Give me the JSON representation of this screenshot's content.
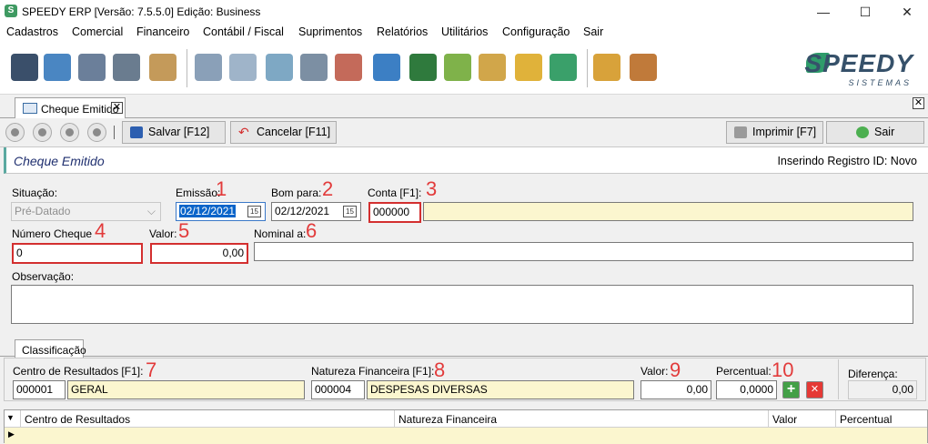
{
  "window": {
    "title": "SPEEDY ERP [Versão: 7.5.5.0] Edição: Business",
    "app_icon": "S"
  },
  "window_controls": {
    "minimize": "—",
    "maximize": "☐",
    "close": "✕"
  },
  "menu": [
    "Cadastros",
    "Comercial",
    "Financeiro",
    "Contábil / Fiscal",
    "Suprimentos",
    "Relatórios",
    "Utilitários",
    "Configuração",
    "Sair"
  ],
  "toolbar_icons": [
    {
      "name": "user-icon",
      "color": "#3a4f6a"
    },
    {
      "name": "client-icon",
      "color": "#4a86c2"
    },
    {
      "name": "group-icon",
      "color": "#6b7f9a"
    },
    {
      "name": "truck-icon",
      "color": "#6a7c8f"
    },
    {
      "name": "box-icon",
      "color": "#c49a5a"
    },
    {
      "name": "calculator-icon",
      "color": "#8aa0b8"
    },
    {
      "name": "document-icon",
      "color": "#9fb4c9"
    },
    {
      "name": "spreadsheet-icon",
      "color": "#7ea8c4"
    },
    {
      "name": "report-icon",
      "color": "#7c8fa3"
    },
    {
      "name": "code-document-icon",
      "color": "#c46a5a"
    },
    {
      "name": "web-icon",
      "color": "#3c7fc4"
    },
    {
      "name": "ledger-icon",
      "color": "#2f7a3d"
    },
    {
      "name": "money-icon",
      "color": "#7fb24a"
    },
    {
      "name": "card-icon",
      "color": "#d1a64a"
    },
    {
      "name": "folder-icon",
      "color": "#e0b23a"
    },
    {
      "name": "book-icon",
      "color": "#3aa06a"
    },
    {
      "name": "keys-user-icon",
      "color": "#d8a23a"
    },
    {
      "name": "exit-door-icon",
      "color": "#c07a3a"
    }
  ],
  "logo": {
    "text": "SPEEDY",
    "sub": "SISTEMAS"
  },
  "doc_tab": {
    "label": "Cheque Emitido",
    "close": "✕"
  },
  "panel_close": "✕",
  "actions": {
    "save": "Salvar [F12]",
    "cancel": "Cancelar [F11]",
    "print": "Imprimir [F7]",
    "exit": "Sair"
  },
  "heading": {
    "title": "Cheque Emitido",
    "status": "Inserindo Registro ID: Novo"
  },
  "form": {
    "situacao_label": "Situação:",
    "situacao_value": "Pré-Datado",
    "emissao_label": "Emissão:",
    "emissao_value": "02/12/2021",
    "bom_para_label": "Bom para:",
    "bom_para_value": "02/12/2021",
    "conta_label": "Conta [F1]:",
    "conta_code": "000000",
    "conta_desc": "",
    "numero_label": "Número Cheque",
    "numero_value": "0",
    "valor_label": "Valor:",
    "valor_value": "0,00",
    "nominal_label": "Nominal a:",
    "nominal_value": "",
    "obs_label": "Observação:",
    "obs_value": ""
  },
  "callouts": [
    "1",
    "2",
    "3",
    "4",
    "5",
    "6",
    "7",
    "8",
    "9",
    "10"
  ],
  "classificacao": {
    "tab": "Classificação",
    "centro_label": "Centro de Resultados [F1]:",
    "centro_code": "000001",
    "centro_desc": "GERAL",
    "natureza_label": "Natureza Financeira [F1]:",
    "natureza_code": "000004",
    "natureza_desc": "DESPESAS DIVERSAS",
    "valor_label": "Valor:",
    "valor_value": "0,00",
    "percentual_label": "Percentual:",
    "percentual_value": "0,0000",
    "diferenca_label": "Diferença:",
    "diferenca_value": "0,00",
    "add": "+",
    "remove": "✕"
  },
  "grid": {
    "columns": [
      "Centro de Resultados",
      "Natureza Financeira",
      "Valor",
      "Percentual"
    ],
    "row_marker": "▶",
    "header_marker": "▼"
  }
}
